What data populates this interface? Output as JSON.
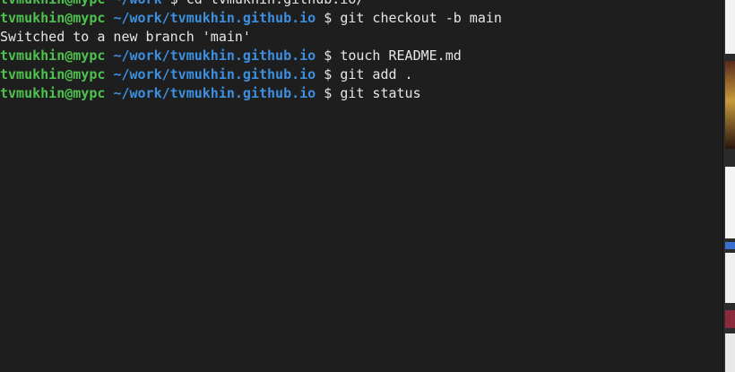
{
  "terminal": {
    "lines": [
      {
        "user": "tvmukhin@mypc",
        "path": "~/work",
        "sign": "$",
        "cmd": "cd tvmukhin.github.io/"
      },
      {
        "user": "tvmukhin@mypc",
        "path": "~/work/tvmukhin.github.io",
        "sign": "$",
        "cmd": "git checkout -b main"
      },
      {
        "output": "Switched to a new branch 'main'"
      },
      {
        "user": "tvmukhin@mypc",
        "path": "~/work/tvmukhin.github.io",
        "sign": "$",
        "cmd": "touch README.md"
      },
      {
        "user": "tvmukhin@mypc",
        "path": "~/work/tvmukhin.github.io",
        "sign": "$",
        "cmd": "git add ."
      },
      {
        "user": "tvmukhin@mypc",
        "path": "~/work/tvmukhin.github.io",
        "sign": "$",
        "cmd": "git status"
      }
    ]
  },
  "colors": {
    "background": "#1e1e1e",
    "user": "#4fc14f",
    "path": "#3d8fe0",
    "text": "#e6e6e6"
  }
}
